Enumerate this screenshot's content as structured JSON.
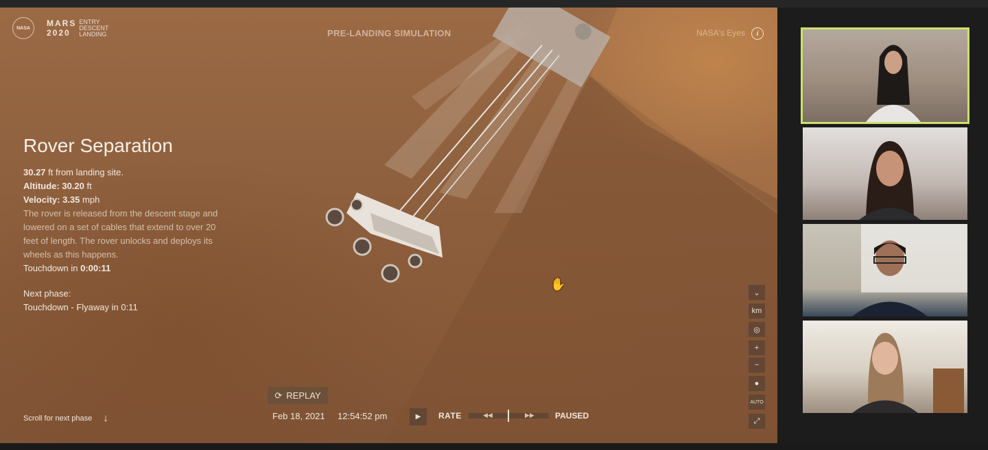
{
  "header": {
    "nasa_badge": "NASA",
    "mars_line1": "MARS",
    "mars_line2": "2020",
    "edl_line1": "ENTRY",
    "edl_line2": "DESCENT",
    "edl_line3": "LANDING",
    "title": "PRE-LANDING SIMULATION",
    "eyes_label": "NASA's Eyes",
    "info_icon": "i"
  },
  "phase": {
    "title": "Rover Separation",
    "distance_value": "30.27",
    "distance_unit": "ft from landing site.",
    "altitude_label": "Altitude:",
    "altitude_value": "30.20",
    "altitude_unit": "ft",
    "velocity_label": "Velocity:",
    "velocity_value": "3.35",
    "velocity_unit": "mph",
    "description": "The rover is released from the descent stage and lowered on a set of cables that extend to over 20 feet of length. The rover unlocks and deploys its wheels as this happens.",
    "touchdown_label": "Touchdown in",
    "touchdown_value": "0:00:11",
    "next_phase_label": "Next phase:",
    "next_phase_value": "Touchdown - Flyaway in 0:11"
  },
  "footer": {
    "scroll_hint": "Scroll for next phase",
    "scroll_icon": "↓",
    "replay_icon": "⟳",
    "replay_label": "REPLAY",
    "date": "Feb 18, 2021",
    "time": "12:54:52 pm",
    "play_icon": "▶",
    "rate_label": "RATE",
    "rewind_icon": "◀◀",
    "forward_icon": "▶▶",
    "status": "PAUSED"
  },
  "controls": {
    "collapse_icon": "⌄",
    "units_label": "km",
    "visibility_icon": "◎",
    "zoom_in_label": "+",
    "zoom_out_label": "−",
    "view_icon": "●",
    "auto_camera_label": "AUTO",
    "fullscreen_icon": "⤢"
  },
  "participants": [
    {
      "icon": "person-icon",
      "active": true
    },
    {
      "icon": "person-icon",
      "active": false
    },
    {
      "icon": "person-icon",
      "active": false
    },
    {
      "icon": "person-icon",
      "active": false
    }
  ],
  "colors": {
    "mars_surface": "#8d5f3d",
    "sky_haze": "#d6964f",
    "active_speaker": "#c9e26b",
    "text_light": "#f2e8de"
  }
}
